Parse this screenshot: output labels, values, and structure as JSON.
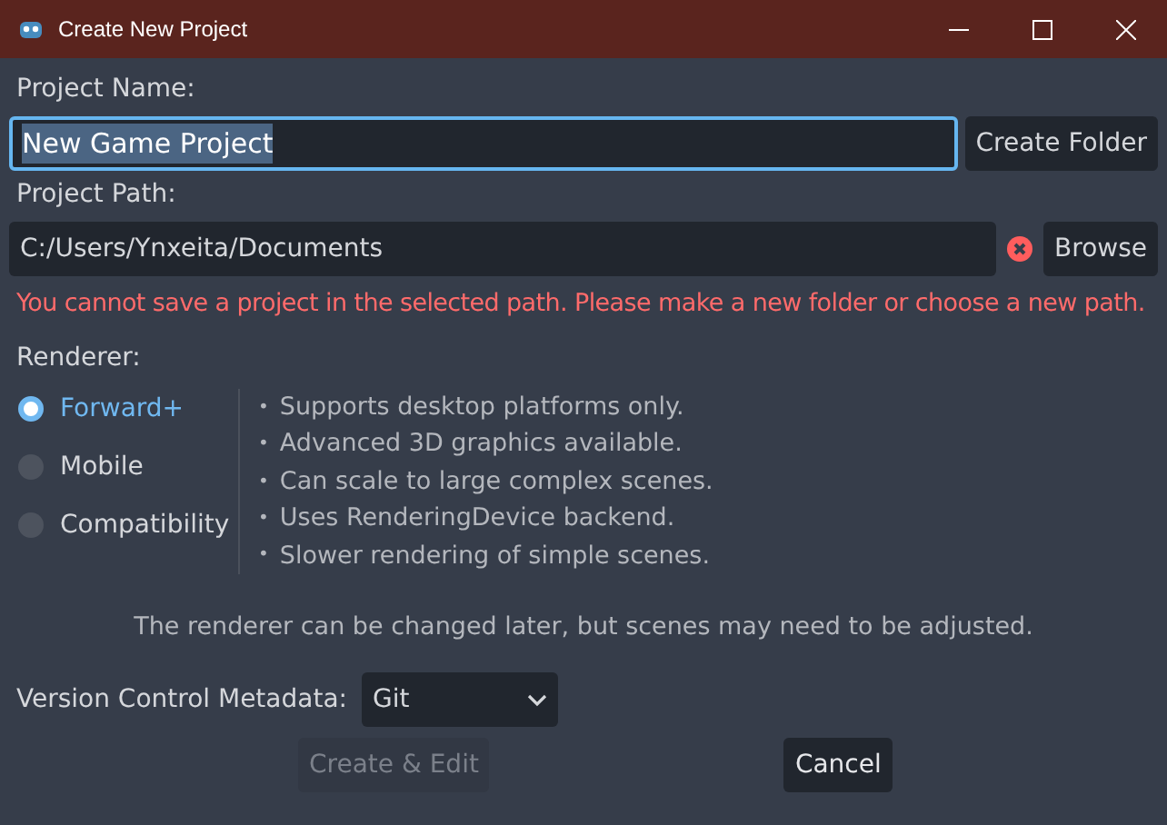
{
  "window": {
    "title": "Create New Project"
  },
  "project_name": {
    "label": "Project Name:",
    "value": "New Game Project",
    "focused": true
  },
  "create_folder_button": {
    "label": "Create Folder"
  },
  "project_path": {
    "label": "Project Path:",
    "value": "C:/Users/Ynxeita/Documents",
    "error": true
  },
  "browse_button": {
    "label": "Browse"
  },
  "error_message": "You cannot save a project in the selected path. Please make a new folder or choose a new path.",
  "renderer": {
    "label": "Renderer:",
    "options": [
      {
        "label": "Forward+",
        "selected": true
      },
      {
        "label": "Mobile",
        "selected": false
      },
      {
        "label": "Compatibility",
        "selected": false
      }
    ],
    "features": [
      {
        "bullet": "•",
        "text": "Supports desktop platforms only."
      },
      {
        "bullet": "•",
        "text": "Advanced 3D graphics available."
      },
      {
        "bullet": "•",
        "text": "Can scale to large complex scenes."
      },
      {
        "bullet": "•",
        "text": "Uses RenderingDevice backend."
      },
      {
        "bullet": "•",
        "text": "Slower rendering of simple scenes."
      }
    ],
    "note": "The renderer can be changed later, but scenes may need to be adjusted."
  },
  "version_control": {
    "label": "Version Control Metadata:",
    "value": "Git"
  },
  "buttons": [
    {
      "label": "Create & Edit",
      "disabled": true
    },
    {
      "label": "Cancel",
      "disabled": false
    }
  ]
}
